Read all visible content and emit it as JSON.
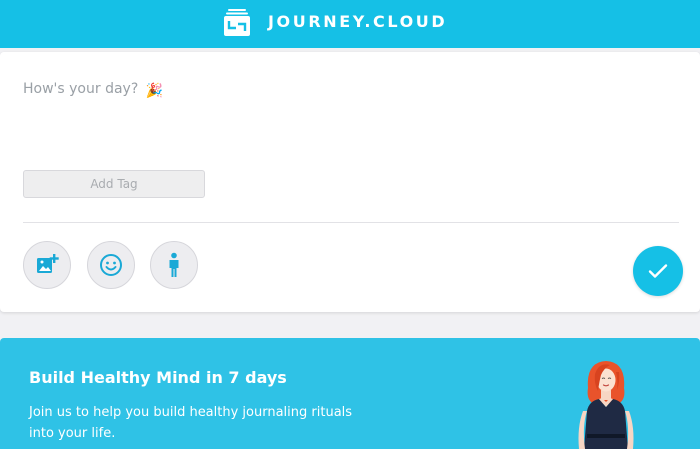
{
  "header": {
    "brand": "JOURNEY.CLOUD",
    "logo_icon": "journey-logo-icon"
  },
  "composer": {
    "placeholder": "How's your day?",
    "placeholder_emoji": "🎉",
    "add_tag_label": "Add Tag",
    "tools": [
      {
        "name": "add-photo",
        "icon": "image-plus-icon"
      },
      {
        "name": "mood",
        "icon": "smiley-icon"
      },
      {
        "name": "activity",
        "icon": "person-icon"
      }
    ],
    "submit_icon": "checkmark-icon"
  },
  "promo": {
    "title": "Build Healthy Mind in 7 days",
    "body": "Join us to help you build healthy journaling rituals into your life."
  },
  "colors": {
    "accent": "#15c0e6",
    "promo_bg": "#2fc2e6",
    "icon": "#1aa9d6"
  }
}
